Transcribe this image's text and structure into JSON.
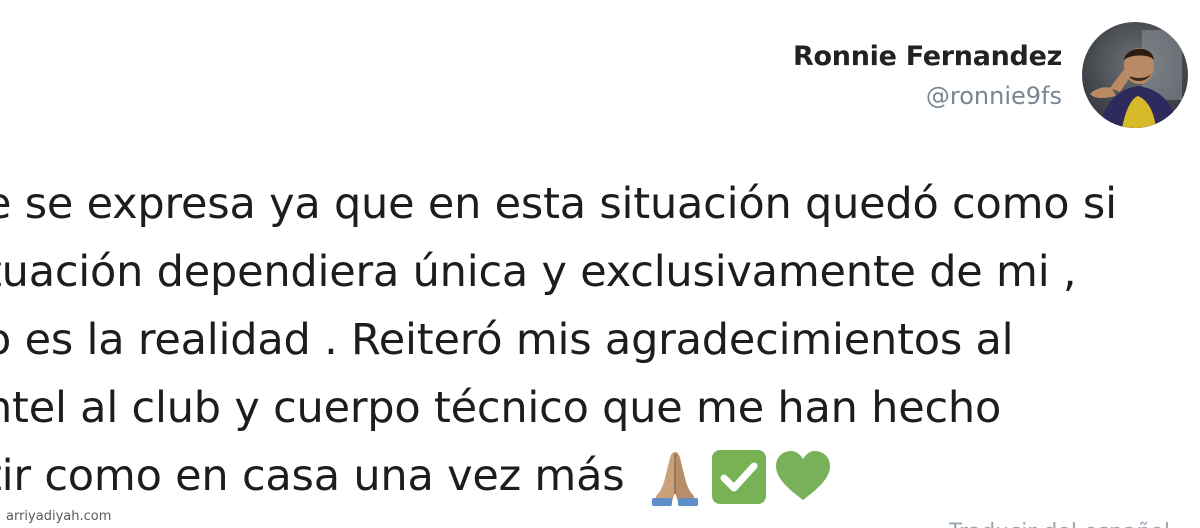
{
  "tweet": {
    "author": {
      "name": "Ronnie Fernandez",
      "handle": "@ronnie9fs"
    },
    "lines": [
      "e se expresa ya que en esta situación quedó como si",
      "tuación dependiera única y exclusivamente de mi ,",
      "o es la realidad . Reiteró mis agradecimientos al",
      "ntel al club y cuerpo técnico que me han hecho",
      "tir como en casa una vez más"
    ],
    "emojis": [
      "folded-hands-icon",
      "check-mark-button-icon",
      "green-heart-icon"
    ],
    "footer_cutoff": "Traducir del español"
  },
  "watermark": "arriyadiyah.com",
  "colors": {
    "text": "#1d1d1d",
    "handle": "#7a8793",
    "check_green": "#77b255",
    "heart_green": "#78b159"
  }
}
